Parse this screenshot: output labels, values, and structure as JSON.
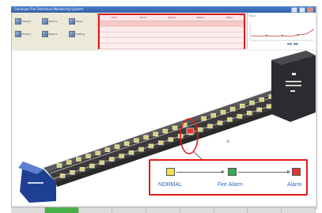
{
  "window": {
    "title": "Conveyor Fire Detection Monitoring System"
  },
  "toolbar": {
    "items": [
      {
        "label": "Monitor",
        "icon": "monitor-icon"
      },
      {
        "label": "Device",
        "icon": "device-icon"
      },
      {
        "label": "Alarm",
        "icon": "alarm-icon"
      },
      {
        "label": "History",
        "icon": "history-icon"
      },
      {
        "label": "Report",
        "icon": "report-icon"
      },
      {
        "label": "Setting",
        "icon": "setting-icon"
      }
    ]
  },
  "alarm_panel": {
    "columns": [
      "Time",
      "Zone",
      "Sensor",
      "Status",
      "Value"
    ]
  },
  "trend": {
    "title": "Trend"
  },
  "legend": {
    "states": [
      {
        "label": "NORMAL",
        "color": "#f2e24a"
      },
      {
        "label": "Fire Alarm",
        "color": "#38a852"
      },
      {
        "label": "Alarm",
        "color": "#e2352b"
      }
    ]
  },
  "colors": {
    "highlight": "#e21a1a",
    "accent_text": "#2f68c6",
    "lamp": "#d9d27a",
    "alarm_lamp": "#e2352b"
  },
  "statusbar": {
    "cells": [
      "",
      "",
      "",
      "",
      "",
      "",
      "",
      "",
      ""
    ]
  }
}
